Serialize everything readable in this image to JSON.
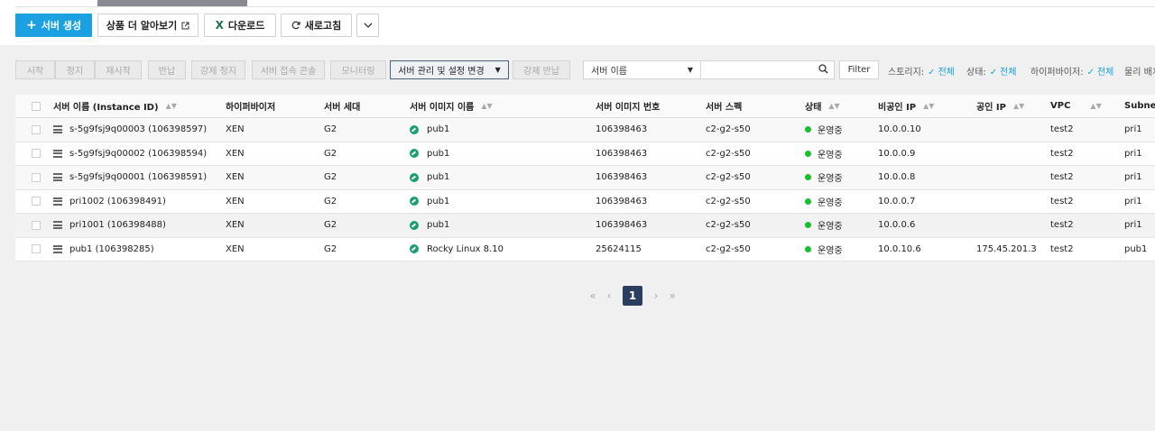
{
  "toolbar": {
    "create": "서버 생성",
    "learn_more": "상품 더 알아보기",
    "download": "다운로드",
    "refresh": "새로고침"
  },
  "actions": {
    "start": "시작",
    "stop": "정지",
    "restart": "재시작",
    "return": "반납",
    "force_stop": "강제 정지",
    "console": "서버 접속 콘솔",
    "monitoring": "모니터링",
    "manage": "서버 관리 및 설정 변경",
    "force_return": "강제 반납"
  },
  "search": {
    "field": "서버 이름",
    "filter": "Filter"
  },
  "filters": [
    {
      "label": "스토리지:",
      "value": "전체"
    },
    {
      "label": "상태:",
      "value": "전체"
    },
    {
      "label": "하이퍼바이저:",
      "value": "전체"
    },
    {
      "label": "물리 배치",
      "value": ""
    }
  ],
  "columns": {
    "name": "서버 이름 (Instance ID)",
    "hypervisor": "하이퍼바이저",
    "gen": "서버 세대",
    "image": "서버 이미지 이름",
    "image_no": "서버 이미지 번호",
    "spec": "서버 스펙",
    "status": "상태",
    "private_ip": "비공인 IP",
    "public_ip": "공인 IP",
    "vpc": "VPC",
    "subnet": "Subnet"
  },
  "rows": [
    {
      "name": "s-5g9fsj9q00003 (106398597)",
      "hypervisor": "XEN",
      "gen": "G2",
      "image": "pub1",
      "image_no": "106398463",
      "spec": "c2-g2-s50",
      "status": "운영중",
      "private_ip": "10.0.0.10",
      "public_ip": "",
      "vpc": "test2",
      "subnet": "pri1"
    },
    {
      "name": "s-5g9fsj9q00002 (106398594)",
      "hypervisor": "XEN",
      "gen": "G2",
      "image": "pub1",
      "image_no": "106398463",
      "spec": "c2-g2-s50",
      "status": "운영중",
      "private_ip": "10.0.0.9",
      "public_ip": "",
      "vpc": "test2",
      "subnet": "pri1"
    },
    {
      "name": "s-5g9fsj9q00001 (106398591)",
      "hypervisor": "XEN",
      "gen": "G2",
      "image": "pub1",
      "image_no": "106398463",
      "spec": "c2-g2-s50",
      "status": "운영중",
      "private_ip": "10.0.0.8",
      "public_ip": "",
      "vpc": "test2",
      "subnet": "pri1"
    },
    {
      "name": "pri1002 (106398491)",
      "hypervisor": "XEN",
      "gen": "G2",
      "image": "pub1",
      "image_no": "106398463",
      "spec": "c2-g2-s50",
      "status": "운영중",
      "private_ip": "10.0.0.7",
      "public_ip": "",
      "vpc": "test2",
      "subnet": "pri1"
    },
    {
      "name": "pri1001 (106398488)",
      "hypervisor": "XEN",
      "gen": "G2",
      "image": "pub1",
      "image_no": "106398463",
      "spec": "c2-g2-s50",
      "status": "운영중",
      "private_ip": "10.0.0.6",
      "public_ip": "",
      "vpc": "test2",
      "subnet": "pri1"
    },
    {
      "name": "pub1 (106398285)",
      "hypervisor": "XEN",
      "gen": "G2",
      "image": "Rocky Linux 8.10",
      "image_no": "25624115",
      "spec": "c2-g2-s50",
      "status": "운영중",
      "private_ip": "10.0.10.6",
      "public_ip": "175.45.201.3",
      "vpc": "test2",
      "subnet": "pub1"
    }
  ],
  "pagination": {
    "current": "1"
  },
  "colors": {
    "primary": "#1ba1e2",
    "status_running": "#17c12c",
    "page_current": "#2c3e5f"
  }
}
